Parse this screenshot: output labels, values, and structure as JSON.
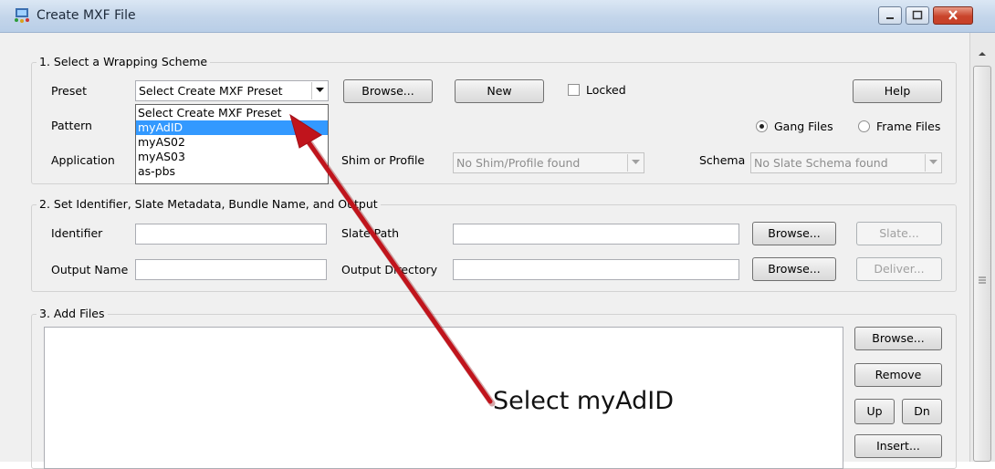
{
  "window": {
    "title": "Create MXF File"
  },
  "section1": {
    "legend": "1. Select a Wrapping Scheme",
    "preset_label": "Preset",
    "preset_value": "Select Create MXF Preset",
    "browse_label": "Browse...",
    "new_label": "New",
    "locked_label": "Locked",
    "locked_checked": false,
    "help_label": "Help",
    "pattern_label": "Pattern",
    "gang_files_label": "Gang Files",
    "frame_files_label": "Frame Files",
    "selected_mode": "Gang Files",
    "application_label": "Application",
    "shim_label": "Shim or Profile",
    "shim_value": "No Shim/Profile found",
    "schema_label": "Schema",
    "schema_value": "No Slate Schema found"
  },
  "preset_dropdown": {
    "items": [
      "Select Create MXF Preset",
      "myAdID",
      "myAS02",
      "myAS03",
      "as-pbs"
    ],
    "highlighted": "myAdID"
  },
  "section2": {
    "legend": "2. Set Identifier, Slate Metadata, Bundle Name, and Output",
    "identifier_label": "Identifier",
    "identifier_value": "",
    "slate_path_label": "Slate Path",
    "slate_path_value": "",
    "browse_label": "Browse...",
    "slate_button_label": "Slate...",
    "output_name_label": "Output Name",
    "output_name_value": "",
    "output_directory_label": "Output Directory",
    "output_directory_value": "",
    "browse2_label": "Browse...",
    "deliver_button_label": "Deliver..."
  },
  "section3": {
    "legend": "3. Add Files",
    "browse_label": "Browse...",
    "remove_label": "Remove",
    "up_label": "Up",
    "dn_label": "Dn",
    "insert_label": "Insert..."
  },
  "annotation": {
    "text": "Select myAdID",
    "arrow_color": "#c0141c"
  },
  "colors": {
    "selection": "#3399ff",
    "close_button": "#c8412a"
  }
}
